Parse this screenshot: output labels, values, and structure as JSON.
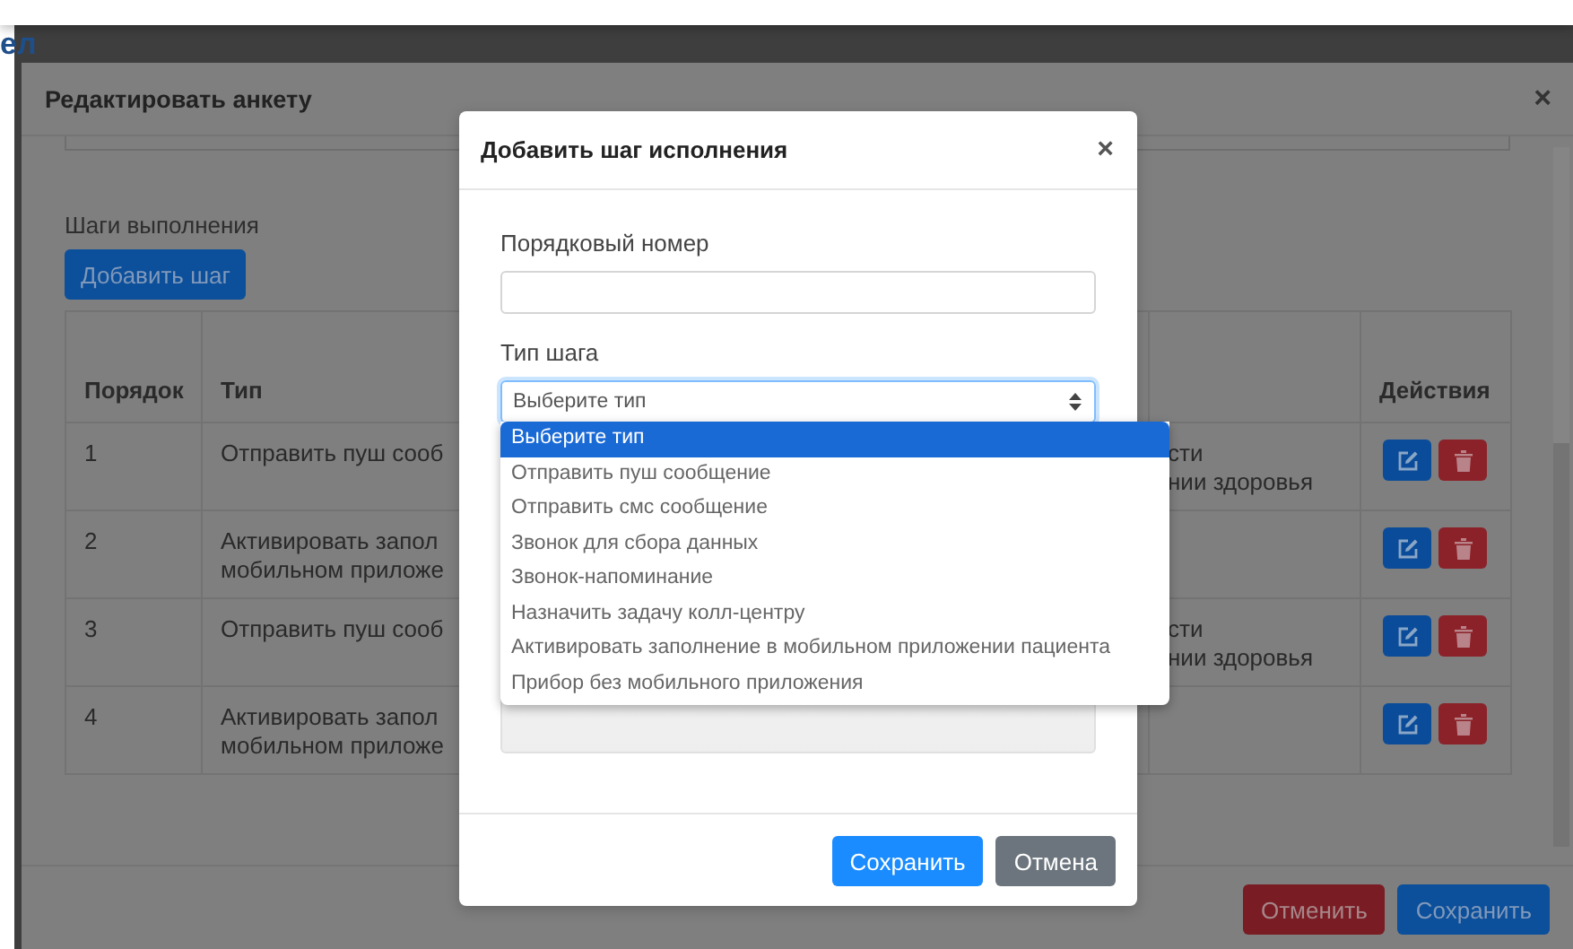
{
  "page": {
    "heading_fragment": "ел"
  },
  "edit_modal": {
    "title": "Редактировать анкету",
    "close": "×",
    "section_label": "Шаги выполнения",
    "add_button": "Добавить шаг",
    "table": {
      "columns": [
        "Порядок",
        "Тип",
        "Действия"
      ],
      "rows": [
        {
          "order": "1",
          "type": [
            "Отправить пуш сооб"
          ],
          "column_3": [
            "сти",
            "нии здоровья"
          ]
        },
        {
          "order": "2",
          "type": [
            "Активировать запол",
            "мобильном приложе"
          ]
        },
        {
          "order": "3",
          "type": [
            "Отправить пуш сооб"
          ],
          "column_3": [
            "сти",
            "нии здоровья"
          ]
        },
        {
          "order": "4",
          "type": [
            "Активировать запол",
            "мобильном приложе"
          ]
        }
      ]
    },
    "buttons": [
      {
        "kind": "danger",
        "label": "Отменить"
      },
      {
        "kind": "primary",
        "label": "Сохранить"
      }
    ]
  },
  "dialog": {
    "title": "Добавить шаг исполнения",
    "close": "×",
    "fields": [
      {
        "kind": "text",
        "label": "Порядковый номер"
      },
      {
        "kind": "select",
        "label": "Тип шага",
        "value": "Выберите тип",
        "open": true,
        "options": [
          {
            "label": "Выберите тип",
            "selected": true
          },
          {
            "label": "Отправить пуш сообщение",
            "selected": false
          },
          {
            "label": "Отправить смс сообщение",
            "selected": false
          },
          {
            "label": "Звонок для сбора данных",
            "selected": false
          },
          {
            "label": "Звонок-напоминание",
            "selected": false
          },
          {
            "label": "Назначить задачу колл-центру",
            "selected": false
          },
          {
            "label": "Активировать заполнение в мобильном приложении пациента",
            "selected": false
          },
          {
            "label": "Прибор без мобильного приложения",
            "selected": false
          }
        ]
      },
      {
        "kind": "textarea"
      }
    ],
    "buttons": [
      {
        "kind": "primary",
        "label": "Сохранить"
      },
      {
        "kind": "secondary",
        "label": "Отмена"
      }
    ]
  }
}
